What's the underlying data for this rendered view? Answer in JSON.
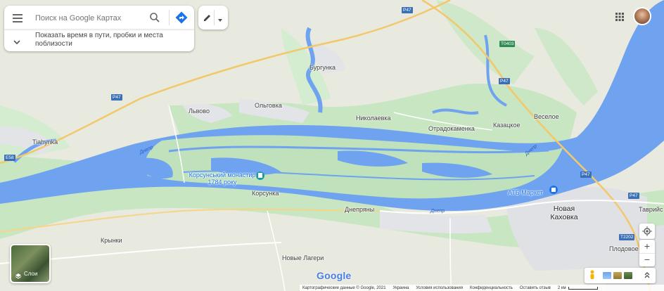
{
  "search": {
    "placeholder": "Поиск на Google Картах"
  },
  "hint": {
    "text": "Показать время в пути, пробки и места поблизости"
  },
  "towns": [
    {
      "name": "Бургунка"
    },
    {
      "name": "Львово"
    },
    {
      "name": "Ольговка"
    },
    {
      "name": "Николаевка"
    },
    {
      "name": "Отрадокаменка"
    },
    {
      "name": "Казацкое"
    },
    {
      "name": "Веселое"
    },
    {
      "name": "Tiahynka"
    },
    {
      "name": "Корсунка"
    },
    {
      "name": "Днепряны"
    },
    {
      "name": "Крынки"
    },
    {
      "name": "Новые Лагери"
    },
    {
      "name": "Плодовое"
    },
    {
      "name": "Таврийс"
    },
    {
      "name": "Новая Каховка"
    }
  ],
  "rivers": [
    {
      "name": "Днепр"
    },
    {
      "name": "Днепр"
    },
    {
      "name": "Днепр"
    }
  ],
  "roads": [
    "P47",
    "P47",
    "P47",
    "T0403",
    "P47",
    "E58",
    "P47",
    "T2202"
  ],
  "pois": {
    "monastery": "Корсунський монастир 1784 року",
    "shop": "АТБ Маркет"
  },
  "layers_label": "Слои",
  "google_logo": "Google",
  "footer": {
    "items": [
      "Картографические данные © Google, 2021",
      "Украина",
      "Условия использования",
      "Конфиденциальность",
      "Оставить отзыв",
      "2 км"
    ]
  },
  "colors": {
    "water": "#6fa3ef",
    "land": "#e9ebdf",
    "green": "#c5e5c0",
    "urban": "#e1e2e6",
    "road": "#f7d488",
    "accent": "#1a73e8"
  }
}
